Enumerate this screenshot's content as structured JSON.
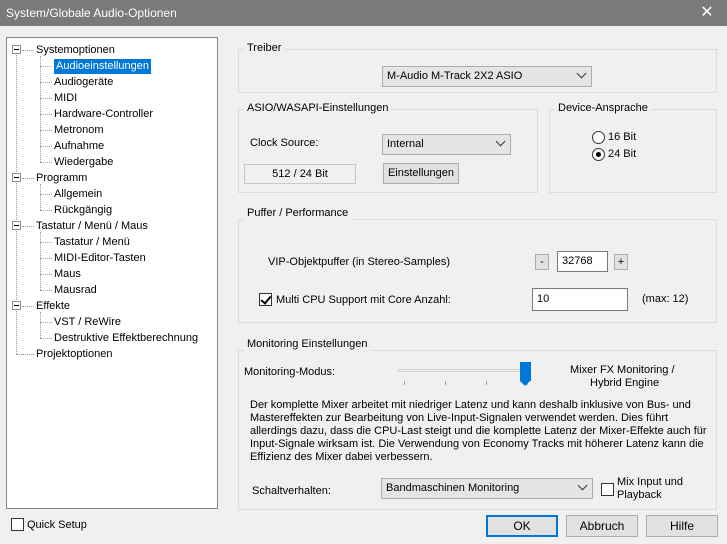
{
  "window": {
    "title": "System/Globale Audio-Optionen",
    "close_glyph": "✕"
  },
  "tree": {
    "items": [
      {
        "label": "Systemoptionen",
        "level": 0,
        "expandable": true
      },
      {
        "label": "Audioeinstellungen",
        "level": 1,
        "selected": true
      },
      {
        "label": "Audiogeräte",
        "level": 1
      },
      {
        "label": "MIDI",
        "level": 1
      },
      {
        "label": "Hardware-Controller",
        "level": 1
      },
      {
        "label": "Metronom",
        "level": 1
      },
      {
        "label": "Aufnahme",
        "level": 1
      },
      {
        "label": "Wiedergabe",
        "level": 1
      },
      {
        "label": "Programm",
        "level": 0,
        "expandable": true
      },
      {
        "label": "Allgemein",
        "level": 1
      },
      {
        "label": "Rückgängig",
        "level": 1
      },
      {
        "label": "Tastatur / Menü / Maus",
        "level": 0,
        "expandable": true
      },
      {
        "label": "Tastatur / Menü",
        "level": 1
      },
      {
        "label": "MIDI-Editor-Tasten",
        "level": 1
      },
      {
        "label": "Maus",
        "level": 1
      },
      {
        "label": "Mausrad",
        "level": 1
      },
      {
        "label": "Effekte",
        "level": 0,
        "expandable": true
      },
      {
        "label": "VST / ReWire",
        "level": 1
      },
      {
        "label": "Destruktive Effektberechnung",
        "level": 1
      },
      {
        "label": "Projektoptionen",
        "level": 0,
        "expandable": false
      }
    ]
  },
  "treiber": {
    "label": "Treiber",
    "value": "M-Audio M-Track 2X2 ASIO"
  },
  "asio": {
    "label": "ASIO/WASAPI-Einstellungen",
    "clock_label": "Clock Source:",
    "clock_value": "Internal",
    "buffer_readout": "512 / 24 Bit",
    "settings_button": "Einstellungen"
  },
  "device": {
    "label": "Device-Ansprache",
    "options": [
      {
        "label": "16 Bit",
        "checked": false
      },
      {
        "label": "24 Bit",
        "checked": true
      }
    ]
  },
  "puffer": {
    "label": "Puffer / Performance",
    "vip_label": "VIP-Objektpuffer (in Stereo-Samples)",
    "minus": "-",
    "vip_value": "32768",
    "plus": "+",
    "multicpu_label": "Multi CPU Support mit Core Anzahl:",
    "multicpu_checked": true,
    "core_value": "10",
    "core_max": "(max: 12)"
  },
  "monitoring": {
    "label": "Monitoring Einstellungen",
    "mode_label": "Monitoring-Modus:",
    "mode_value": "Mixer FX Monitoring /",
    "mode_value_2": "Hybrid Engine",
    "slider_fraction": 1.0,
    "description": [
      "Der komplette Mixer arbeitet mit niedriger Latenz und kann deshalb inklusive von Bus- und",
      "Mastereffekten zur Bearbeitung von Live-Input-Signalen verwendet werden. Dies führt",
      "allerdings dazu, dass die CPU-Last steigt und die komplette Latenz der Mixer-Effekte auch für",
      "Input-Signale wirksam ist. Die Verwendung von Economy Tracks mit höherer Latenz kann die",
      "Effizienz des Mixer dabei verbessern."
    ],
    "switch_label": "Schaltverhalten:",
    "switch_value": "Bandmaschinen Monitoring",
    "mix_label": "Mix Input und",
    "mix_label_2": "Playback",
    "mix_checked": false
  },
  "footer": {
    "quick_setup": "Quick Setup",
    "ok": "OK",
    "cancel": "Abbruch",
    "help": "Hilfe"
  },
  "colors": {
    "accent": "#0078d7",
    "titlebar": "#7a7a7a"
  }
}
